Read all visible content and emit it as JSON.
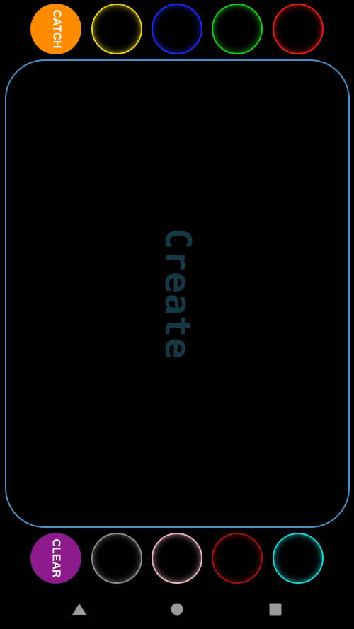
{
  "top_row": {
    "catch_label": "CATCH",
    "catch_color": "#FF8C00",
    "rings": [
      {
        "name": "yellow",
        "color": "#E6D21E"
      },
      {
        "name": "blue",
        "color": "#1E2EE6"
      },
      {
        "name": "green",
        "color": "#1EC81E"
      },
      {
        "name": "red",
        "color": "#E61E1E"
      }
    ]
  },
  "canvas": {
    "hint_text": "Create",
    "border_color": "#4D8FC0"
  },
  "bottom_row": {
    "clear_label": "CLEAR",
    "clear_color": "#8B1A8B",
    "rings": [
      {
        "name": "gray",
        "color": "#8C8C8C"
      },
      {
        "name": "pink",
        "color": "#E8B4C0"
      },
      {
        "name": "dark-red",
        "color": "#A01414"
      },
      {
        "name": "cyan",
        "color": "#1ED2D2"
      }
    ]
  },
  "nav_bar": {
    "back_icon": "triangle-back-icon",
    "home_icon": "circle-home-icon",
    "recents_icon": "square-recents-icon"
  }
}
